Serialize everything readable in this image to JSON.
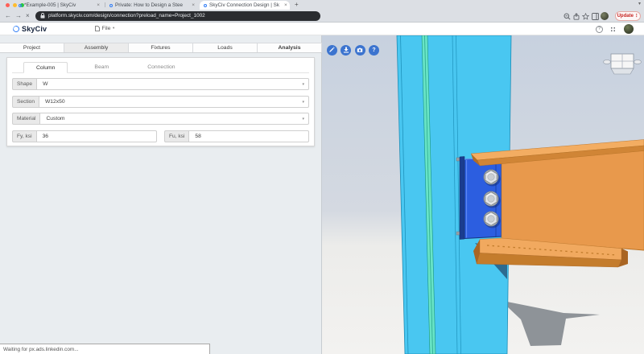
{
  "browser": {
    "chevron": "▾",
    "tabs": [
      {
        "title": "*Example-005 | SkyCiv",
        "close": "×"
      },
      {
        "title": "Private: How to Design a Stee",
        "close": "×"
      },
      {
        "title": "SkyCiv Connection Design | Sk",
        "close": "×"
      }
    ],
    "new_tab_label": "+",
    "nav": {
      "back": "←",
      "forward": "→",
      "stop": "×"
    },
    "url": "platform.skyciv.com/design/connection?preload_name=Project_1002",
    "update_label": "Update",
    "menu_dots": "⋮"
  },
  "app_header": {
    "logo_text": "SkyCiv",
    "file_label": "File",
    "file_caret": "▾",
    "help": "?"
  },
  "panel": {
    "tabs": [
      {
        "label": "Project"
      },
      {
        "label": "Assembly"
      },
      {
        "label": "Fixtures"
      },
      {
        "label": "Loads"
      },
      {
        "label": "Analysis"
      }
    ],
    "subtabs": [
      {
        "label": "Column"
      },
      {
        "label": "Beam"
      },
      {
        "label": "Connection"
      }
    ],
    "dropdown_caret": "▾",
    "fields": {
      "shape": {
        "label": "Shape",
        "value": "W"
      },
      "section": {
        "label": "Section",
        "value": "W12x50"
      },
      "material": {
        "label": "Material",
        "value": "Custom"
      },
      "fy": {
        "label": "Fy, ksi",
        "value": "36"
      },
      "fu": {
        "label": "Fu, ksi",
        "value": "58"
      }
    }
  },
  "viewport": {
    "help_label": "?",
    "colors": {
      "column": "#49c7f1",
      "beam": "#e8994c",
      "plate": "#2c5ee0",
      "toolbar_button": "#3c74cf"
    }
  },
  "status_bar": {
    "text": "Waiting for px.ads.linkedin.com..."
  }
}
